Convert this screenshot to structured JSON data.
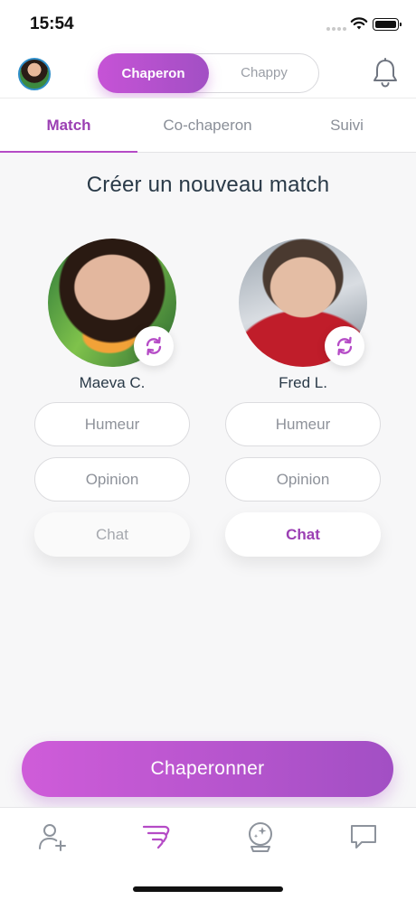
{
  "status_bar": {
    "time": "15:54"
  },
  "header": {
    "mode_active": "Chaperon",
    "mode_inactive": "Chappy"
  },
  "tabs": [
    {
      "label": "Match",
      "active": true
    },
    {
      "label": "Co-chaperon",
      "active": false
    },
    {
      "label": "Suivi",
      "active": false
    }
  ],
  "main": {
    "title": "Créer un nouveau match",
    "people": [
      {
        "name": "Maeva C.",
        "humeur": "Humeur",
        "opinion": "Opinion",
        "chat": "Chat",
        "chat_enabled": false
      },
      {
        "name": "Fred L.",
        "humeur": "Humeur",
        "opinion": "Opinion",
        "chat": "Chat",
        "chat_enabled": true
      }
    ],
    "cta_label": "Chaperonner"
  },
  "bottom_nav": {
    "items": [
      {
        "icon": "add-user-icon"
      },
      {
        "icon": "chaperon-wings-icon",
        "active": true
      },
      {
        "icon": "crystal-ball-icon"
      },
      {
        "icon": "chat-bubble-icon"
      }
    ]
  },
  "colors": {
    "accent": "#b54bc6",
    "accent_dark": "#9b3fb3",
    "gradient_start": "#cf5cd9",
    "gradient_end": "#a24fc4"
  }
}
